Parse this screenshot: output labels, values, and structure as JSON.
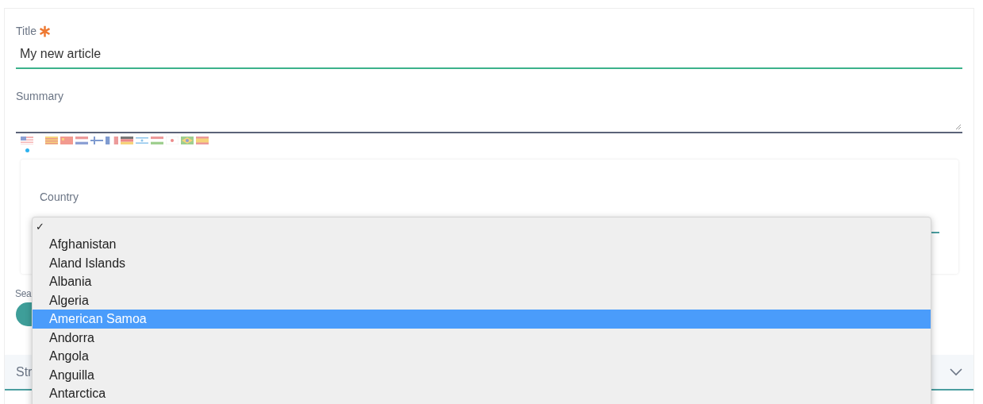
{
  "title_field": {
    "label": "Title",
    "required": true,
    "value": "My new article"
  },
  "summary_field": {
    "label": "Summary"
  },
  "flags": [
    {
      "kind": "us",
      "selected": true
    },
    {
      "kind": "catalan",
      "selected": false
    },
    {
      "kind": "china",
      "selected": false
    },
    {
      "kind": "netherlands",
      "selected": false
    },
    {
      "kind": "finland",
      "selected": false
    },
    {
      "kind": "france",
      "selected": false
    },
    {
      "kind": "germany",
      "selected": false
    },
    {
      "kind": "israel",
      "selected": false
    },
    {
      "kind": "hungary",
      "selected": false
    },
    {
      "kind": "japan",
      "selected": false
    },
    {
      "kind": "brazil",
      "selected": false
    },
    {
      "kind": "spain",
      "selected": false
    }
  ],
  "country_field": {
    "label": "Country"
  },
  "dropdown": {
    "check_mark": "✓",
    "options": [
      {
        "label": "Afghanistan",
        "selected": false
      },
      {
        "label": "Aland Islands",
        "selected": false
      },
      {
        "label": "Albania",
        "selected": false
      },
      {
        "label": "Algeria",
        "selected": false
      },
      {
        "label": "American Samoa",
        "selected": true
      },
      {
        "label": "Andorra",
        "selected": false
      },
      {
        "label": "Angola",
        "selected": false
      },
      {
        "label": "Anguilla",
        "selected": false
      },
      {
        "label": "Antarctica",
        "selected": false
      }
    ]
  },
  "partial_label": "Sea",
  "section_header": {
    "label": "Str"
  }
}
